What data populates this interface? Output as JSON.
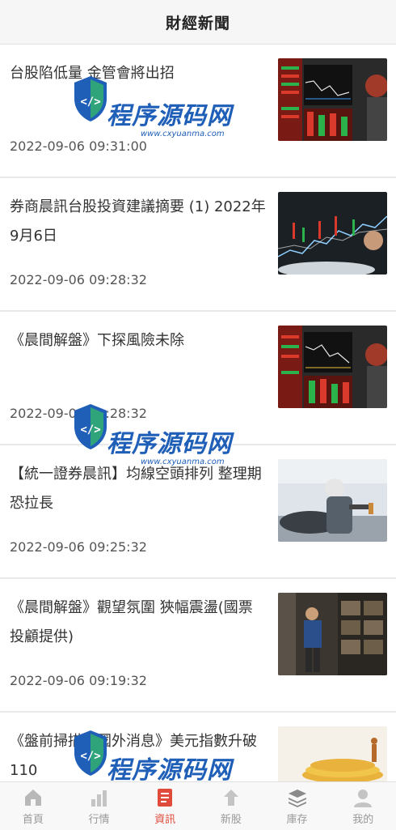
{
  "header": {
    "title": "財經新聞"
  },
  "news": [
    {
      "headline": "台股陷低量 金管會將出招",
      "time": "2022-09-06 09:31:00",
      "thumb_icon": "stock-screen-photo"
    },
    {
      "headline": "券商晨訊台股投資建議摘要 (1) 2022年9月6日",
      "time": "2022-09-06 09:28:32",
      "thumb_icon": "trading-chart-photo"
    },
    {
      "headline": "《晨間解盤》下探風險未除",
      "time": "2022-09-06 09:28:32",
      "thumb_icon": "stock-screen-photo"
    },
    {
      "headline": "【統一證券晨訊】均線空頭排列 整理期恐拉長",
      "time": "2022-09-06 09:25:32",
      "thumb_icon": "factory-worker-photo"
    },
    {
      "headline": "《晨間解盤》觀望氛圍 狹幅震盪(國票投顧提供)",
      "time": "2022-09-06 09:19:32",
      "thumb_icon": "server-room-photo"
    },
    {
      "headline": "《盤前掃描》國外消息》美元指數升破110",
      "time": "",
      "thumb_icon": "coins-photo"
    }
  ],
  "tabs": [
    {
      "label": "首頁",
      "icon": "home-icon",
      "active": false
    },
    {
      "label": "行情",
      "icon": "chart-icon",
      "active": false
    },
    {
      "label": "資訊",
      "icon": "news-icon",
      "active": true
    },
    {
      "label": "新股",
      "icon": "new-stock-icon",
      "active": false
    },
    {
      "label": "庫存",
      "icon": "layers-icon",
      "active": false
    },
    {
      "label": "我的",
      "icon": "user-icon",
      "active": false
    }
  ],
  "watermark": {
    "brand": "程序源码网",
    "domain": "www.cxyuanma.com"
  },
  "colors": {
    "accent": "#e04b3c",
    "muted": "#999999",
    "watermark": "#1f5fb8"
  }
}
